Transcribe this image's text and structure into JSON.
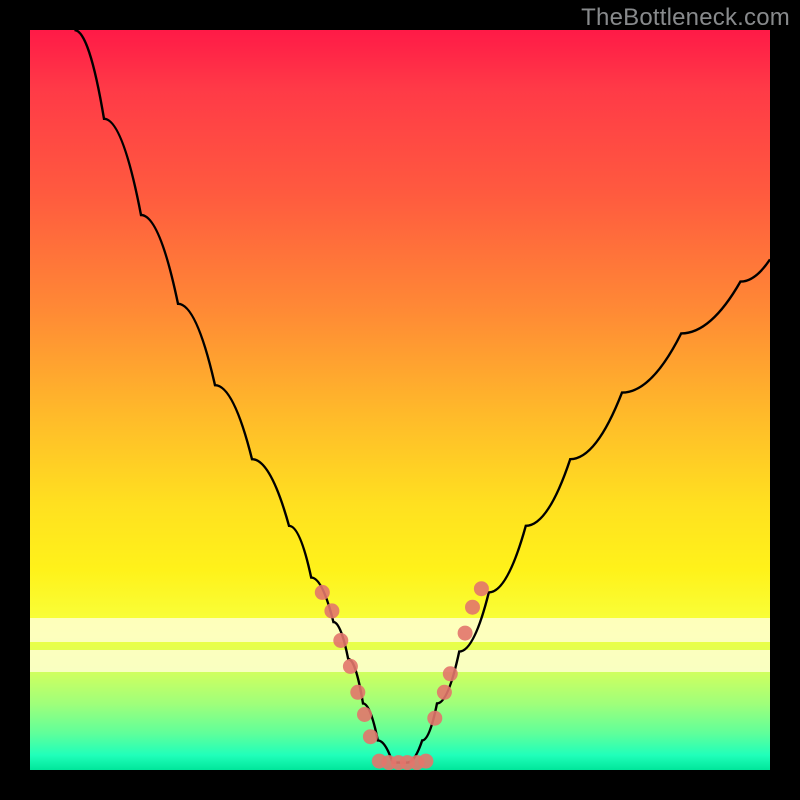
{
  "watermark": "TheBottleneck.com",
  "chart_data": {
    "type": "line",
    "title": "",
    "xlabel": "",
    "ylabel": "",
    "xlim": [
      0,
      100
    ],
    "ylim": [
      0,
      100
    ],
    "grid": false,
    "legend": false,
    "background_gradient": [
      "#ff1a47",
      "#ffba2a",
      "#fff21a",
      "#00e69a"
    ],
    "description": "V-shaped bottleneck curve. Y axis high = worse. Curve drops steeply from top-left, flattens to minimum around x≈47-53, rises toward upper-right. Salmon dots mark sampled points on both arms of the V near the minimum.",
    "series": [
      {
        "name": "curve",
        "type": "line",
        "x": [
          6,
          10,
          15,
          20,
          25,
          30,
          35,
          38,
          41,
          43,
          45,
          47,
          49,
          51,
          53,
          55,
          58,
          62,
          67,
          73,
          80,
          88,
          96,
          100
        ],
        "y": [
          100,
          88,
          75,
          63,
          52,
          42,
          33,
          26,
          20,
          15,
          9,
          4,
          1,
          1,
          4,
          9,
          16,
          24,
          33,
          42,
          51,
          59,
          66,
          69
        ]
      },
      {
        "name": "left-arm-dots",
        "type": "scatter",
        "color": "#e2756c",
        "x": [
          39.5,
          40.8,
          42.0,
          43.3,
          44.3,
          45.2,
          46.0
        ],
        "y": [
          24.0,
          21.5,
          17.5,
          14.0,
          10.5,
          7.5,
          4.5
        ]
      },
      {
        "name": "right-arm-dots",
        "type": "scatter",
        "color": "#e2756c",
        "x": [
          54.7,
          56.0,
          56.8,
          58.8,
          59.8,
          61.0
        ],
        "y": [
          7.0,
          10.5,
          13.0,
          18.5,
          22.0,
          24.5
        ]
      },
      {
        "name": "floor-dots",
        "type": "scatter",
        "color": "#e2756c",
        "x": [
          47.2,
          48.5,
          49.8,
          51.0,
          52.3,
          53.5
        ],
        "y": [
          1.2,
          1.0,
          1.0,
          1.0,
          1.0,
          1.2
        ]
      }
    ]
  }
}
